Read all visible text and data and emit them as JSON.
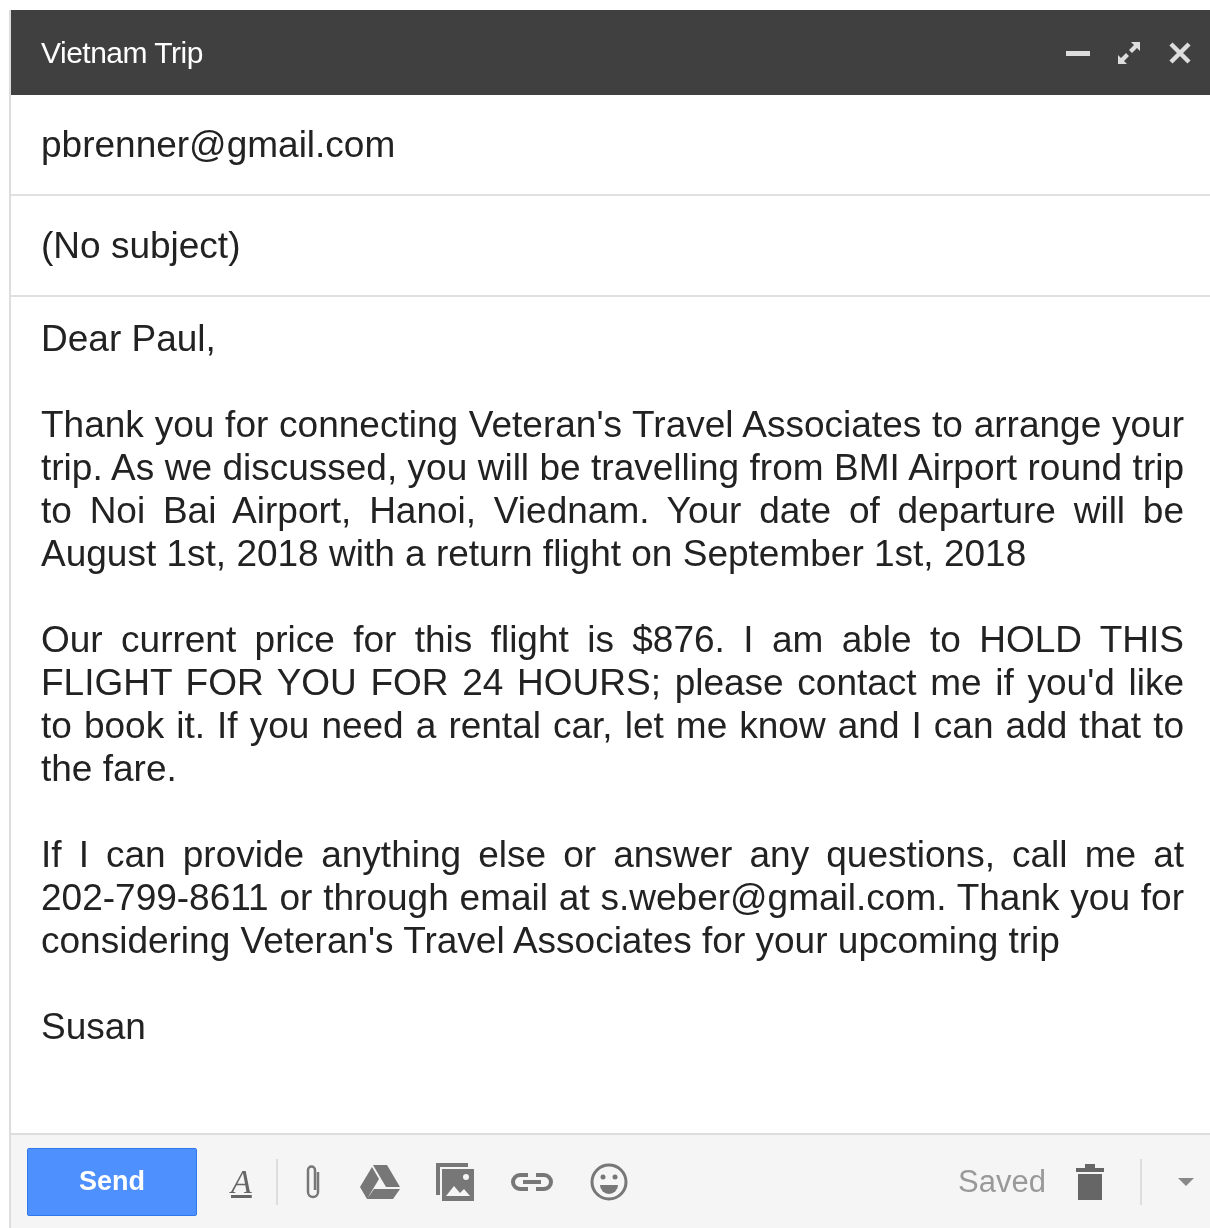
{
  "window": {
    "title": "Vietnam Trip"
  },
  "recipient": "pbrenner@gmail.com",
  "subject": "(No subject)",
  "body": [
    "Dear Paul,",
    "Thank you for connecting Veteran's Travel Associates to arrange your trip. As we discussed, you will be travelling from BMI Airport round trip to Noi Bai Airport, Hanoi, Viednam. Your date of departure will be August 1st, 2018 with a return flight on September 1st, 2018",
    "Our current price for this flight is $876. I am able to HOLD THIS FLIGHT FOR YOU FOR 24 HOURS; please contact me if you'd like to book it. If you need a rental car, let me know and I can add that to the fare.",
    "If I can provide anything else or answer any questions, call me at 202-799-8611 or through email at s.weber@gmail.com. Thank you for considering Veteran's Travel Associates for your upcoming trip",
    "Susan"
  ],
  "toolbar": {
    "send": "Send",
    "formatting": "A",
    "status": "Saved"
  }
}
